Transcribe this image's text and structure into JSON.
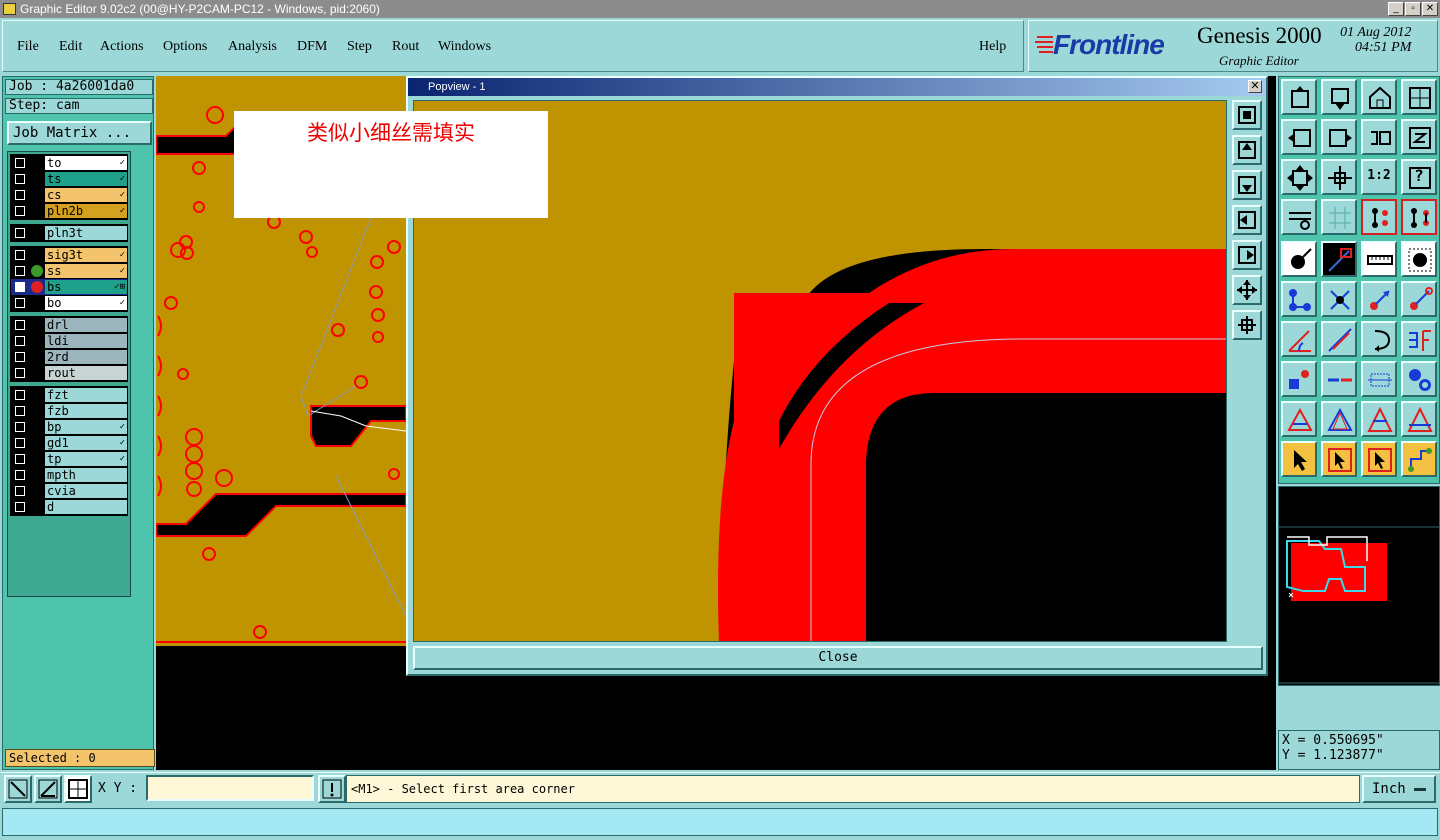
{
  "window": {
    "title": "Graphic Editor 9.02c2 (00@HY-P2CAM-PC12 - Windows, pid:2060)"
  },
  "menu": [
    "File",
    "Edit",
    "Actions",
    "Options",
    "Analysis",
    "DFM",
    "Step",
    "Rout",
    "Windows"
  ],
  "help_label": "Help",
  "brand": {
    "logo": "Frontline",
    "product": "Genesis 2000",
    "date": "01 Aug 2012",
    "time": "04:51 PM",
    "subtitle": "Graphic Editor"
  },
  "job": {
    "job_label": "Job : 4a26001da0",
    "step_label": "Step: cam",
    "matrix_button": "Job Matrix ..."
  },
  "layer_groups": [
    [
      {
        "name": "to",
        "bg": "#ffffff",
        "flag": "✓"
      },
      {
        "name": "ts",
        "bg": "#1ea08a",
        "flag": "✓"
      },
      {
        "name": "cs",
        "bg": "#f4c46c",
        "flag": "✓"
      },
      {
        "name": "pln2b",
        "bg": "#d4a020",
        "flag": "✓"
      }
    ],
    [
      {
        "name": "pln3t",
        "bg": "#9cd8d8",
        "flag": ""
      }
    ],
    [
      {
        "name": "sig3t",
        "bg": "#f4c46c",
        "flag": "✓"
      },
      {
        "name": "ss",
        "bg": "#f4c46c",
        "flag": "✓",
        "dot": "#3a9a2a"
      },
      {
        "name": "bs",
        "bg": "#1ea08a",
        "flag": "✓⊞",
        "dot": "#e02020",
        "checked": true
      },
      {
        "name": "bo",
        "bg": "#ffffff",
        "flag": "✓"
      }
    ],
    [
      {
        "name": "drl",
        "bg": "#9cb4bc",
        "flag": ""
      },
      {
        "name": "ldi",
        "bg": "#9cb4bc",
        "flag": ""
      },
      {
        "name": "2rd",
        "bg": "#9cb4bc",
        "flag": ""
      },
      {
        "name": "rout",
        "bg": "#c8d4d4",
        "flag": ""
      }
    ],
    [
      {
        "name": "fzt",
        "bg": "#9cd8d8",
        "flag": ""
      },
      {
        "name": "fzb",
        "bg": "#9cd8d8",
        "flag": ""
      },
      {
        "name": "bp",
        "bg": "#9cd8d8",
        "flag": "✓"
      },
      {
        "name": "gd1",
        "bg": "#9cd8d8",
        "flag": "✓"
      },
      {
        "name": "tp",
        "bg": "#9cd8d8",
        "flag": "✓"
      },
      {
        "name": "mpth",
        "bg": "#9cd8d8",
        "flag": ""
      },
      {
        "name": "cvia",
        "bg": "#9cd8d8",
        "flag": ""
      },
      {
        "name": "d",
        "bg": "#9cd8d8",
        "flag": ""
      }
    ]
  ],
  "selected_label": "Selected : 0",
  "popview": {
    "title": "Popview - 1",
    "close_label": "Close"
  },
  "annotation": "类似小细丝需填实",
  "tool_texts": {
    "zoom_ratio": "1:2",
    "help": "?"
  },
  "coords": {
    "x": "X = 0.550695\"",
    "y": "Y = 1.123877\""
  },
  "xy_label": "X Y :",
  "xy_value": "",
  "status_message": "<M1> - Select first area corner",
  "unit": "Inch",
  "colors": {
    "board": "#bf9400",
    "feature": "#ff0000",
    "background": "#000000",
    "panel": "#9cd8d8"
  }
}
